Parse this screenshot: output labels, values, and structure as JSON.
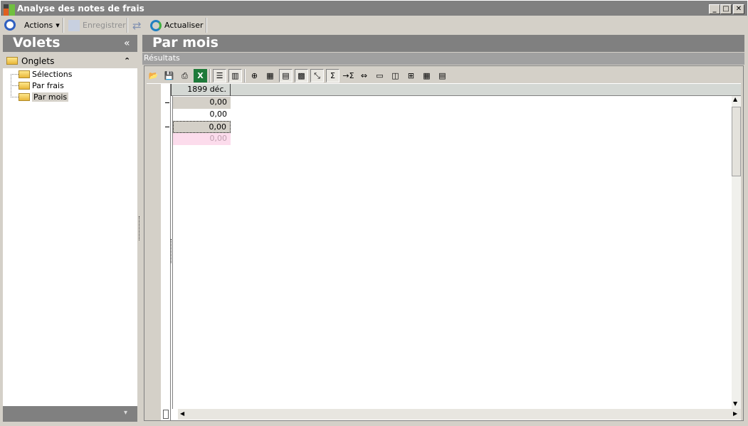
{
  "window": {
    "title": "Analyse des notes de frais",
    "minimize": "_",
    "maximize": "□",
    "close": "✕"
  },
  "toolbar": {
    "actions": "Actions",
    "actions_arrow": "▾",
    "save": "Enregistrer",
    "refresh": "Actualiser"
  },
  "left_panel": {
    "title": "Volets",
    "collapse": "«",
    "section": "Onglets",
    "section_toggle": "⌃",
    "items": [
      {
        "label": "Sélections"
      },
      {
        "label": "Par frais"
      },
      {
        "label": "Par mois"
      }
    ],
    "footer_arrow": "▾"
  },
  "main": {
    "title": "Par mois",
    "subtitle": "Résultats"
  },
  "grid_toolbar": {
    "icons": [
      "open-icon",
      "save-icon",
      "print-icon",
      "excel-icon",
      "rows-layout-icon",
      "columns-layout-icon",
      "add-field-icon",
      "grid-icon",
      "grid-lines-icon",
      "grid-dotted-icon",
      "pivot-swap-icon",
      "sort-sum-icon",
      "insert-total-icon",
      "column-width-icon",
      "horizontal-layout-icon",
      "vertical-layout-icon",
      "cross-layout-icon",
      "expand-all-icon",
      "collapse-all-icon"
    ]
  },
  "grid": {
    "column_header": "1899 déc.",
    "rows": [
      "0,00",
      "0,00",
      "0,00",
      "0,00"
    ]
  }
}
